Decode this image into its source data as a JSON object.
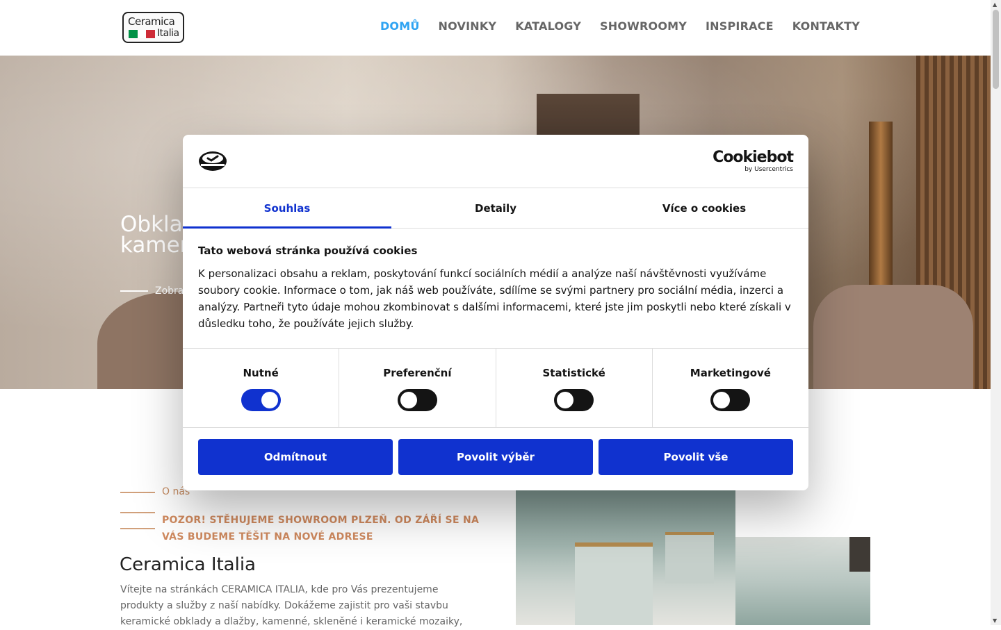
{
  "header": {
    "logo": {
      "top": "Ceramica",
      "bottom": "Italia",
      "flag_colors": [
        "#009246",
        "#ffffff",
        "#ce2b37"
      ]
    },
    "nav": [
      {
        "label": "DOMŮ",
        "active": true
      },
      {
        "label": "NOVINKY",
        "active": false
      },
      {
        "label": "KATALOGY",
        "active": false
      },
      {
        "label": "SHOWROOMY",
        "active": false
      },
      {
        "label": "INSPIRACE",
        "active": false
      },
      {
        "label": "KONTAKTY",
        "active": false
      }
    ],
    "active_color": "#2ea3f2"
  },
  "hero": {
    "title_line1": "Obkla",
    "title_line2": "kamer",
    "link": "Zobra"
  },
  "about": {
    "label": "O nás",
    "alert": "POZOR! STĚHUJEME SHOWROOM PLZEŇ. OD ZÁŘÍ SE NA VÁS BUDEME TĚŠIT NA NOVÉ ADRESE",
    "title": "Ceramica Italia",
    "text": "Vítejte na stránkách CERAMICA ITALIA, kde pro Vás prezentujeme produkty a služby z naší nabídky. Dokážeme zajistit pro vaši stavbu keramické obklady a dlažby, kamenné, skleněné i keramické mozaiky,"
  },
  "cookie_dialog": {
    "brand": "Cookiebot",
    "brand_sub": "by Usercentrics",
    "tabs": [
      {
        "label": "Souhlas",
        "active": true
      },
      {
        "label": "Detaily",
        "active": false
      },
      {
        "label": "Více o cookies",
        "active": false
      }
    ],
    "title": "Tato webová stránka používá cookies",
    "text": "K personalizaci obsahu a reklam, poskytování funkcí sociálních médií a analýze naší návštěvnosti využíváme soubory cookie. Informace o tom, jak náš web používáte, sdílíme se svými partnery pro sociální média, inzerci a analýzy. Partneři tyto údaje mohou zkombinovat s dalšími informacemi, které jste jim poskytli nebo které získali v důsledku toho, že používáte jejich služby.",
    "toggles": [
      {
        "label": "Nutné",
        "on": true
      },
      {
        "label": "Preferenční",
        "on": false
      },
      {
        "label": "Statistické",
        "on": false
      },
      {
        "label": "Marketingové",
        "on": false
      }
    ],
    "buttons": {
      "reject": "Odmítnout",
      "allow_selection": "Povolit výběr",
      "allow_all": "Povolit vše"
    },
    "accent_color": "#1032cf"
  }
}
